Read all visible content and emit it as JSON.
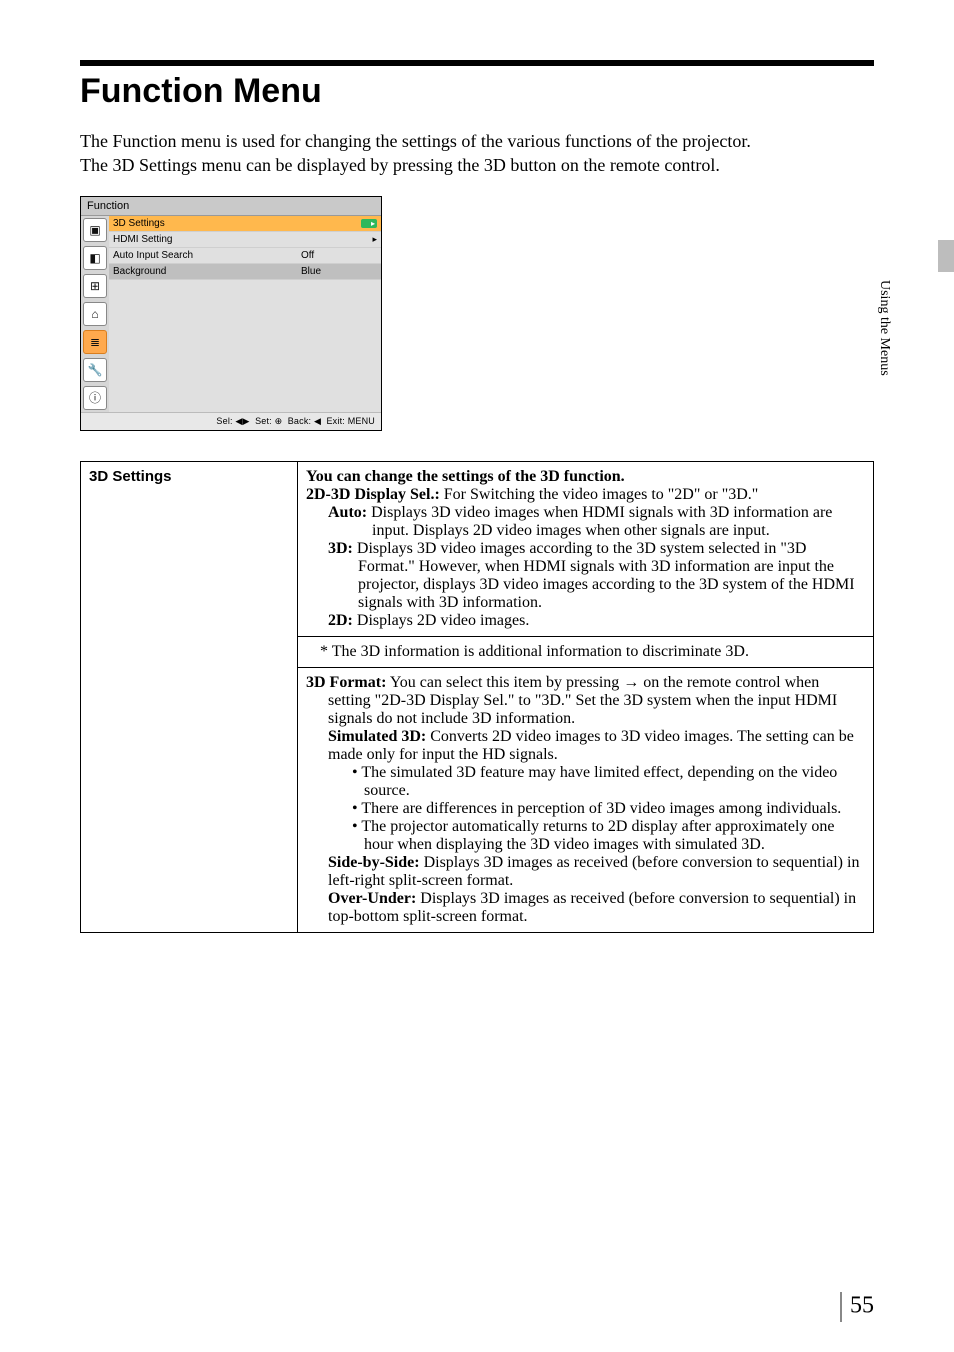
{
  "header": {
    "title": "Function Menu",
    "intro_p1": "The Function menu is used for changing the settings of the various functions of the projector.",
    "intro_p2": "The 3D Settings menu can be displayed by pressing the 3D button on the remote control."
  },
  "side": {
    "label": "Using the Menus"
  },
  "menu": {
    "title": "Function",
    "rows": [
      {
        "label": "3D Settings",
        "value": "",
        "arrow": "▸",
        "selected": true
      },
      {
        "label": "HDMI Setting",
        "value": "",
        "arrow": "▸",
        "selected": false
      },
      {
        "label": "Auto Input Search",
        "value": "Off",
        "arrow": "",
        "selected": false
      },
      {
        "label": "Background",
        "value": "Blue",
        "arrow": "",
        "selected": false,
        "dark": true
      }
    ],
    "footer": {
      "sel": "Sel:",
      "set": "Set:",
      "back": "Back:",
      "exit": "Exit:"
    }
  },
  "spec": {
    "row_label": "3D Settings",
    "lead": "You can change the settings of the 3D function.",
    "d2d3_sel_label": "2D-3D Display Sel.:",
    "d2d3_sel_text": " For Switching the video images to \"2D\" or \"3D.\"",
    "auto_label": "Auto:",
    "auto_text": " Displays 3D video images when HDMI signals with 3D information are input. Displays 2D video images when other signals are input.",
    "d3_label": "3D:",
    "d3_text": " Displays 3D video images according to the 3D system selected in \"3D Format.\" However, when HDMI signals with 3D information are input the projector, displays 3D video images according to the 3D system of the HDMI signals with 3D information.",
    "d2_label": "2D:",
    "d2_text": " Displays 2D video images.",
    "note_text": "* The 3D information is additional information to discriminate 3D.",
    "format_label": "3D Format:",
    "format_text": " You can select this item by pressing → on the remote control when setting \"2D-3D Display Sel.\" to \"3D.\" Set the 3D system when the input HDMI signals do not include 3D information.",
    "sim3d_label": "Simulated 3D:",
    "sim3d_text": " Converts 2D video images to 3D video images. The setting can be made only for input the HD signals.",
    "bullet1": "• The simulated 3D feature may have limited effect, depending on the video source.",
    "bullet2": "• There are differences in perception of 3D video images among individuals.",
    "bullet3": "• The projector automatically returns to 2D display after approximately one hour when displaying the 3D video images with simulated 3D.",
    "sbs_label": "Side-by-Side:",
    "sbs_text": " Displays 3D images as received (before conversion to sequential) in left-right split-screen format.",
    "ou_label": "Over-Under:",
    "ou_text": " Displays 3D images as received (before conversion to sequential) in top-bottom split-screen format."
  },
  "page_number": "55"
}
